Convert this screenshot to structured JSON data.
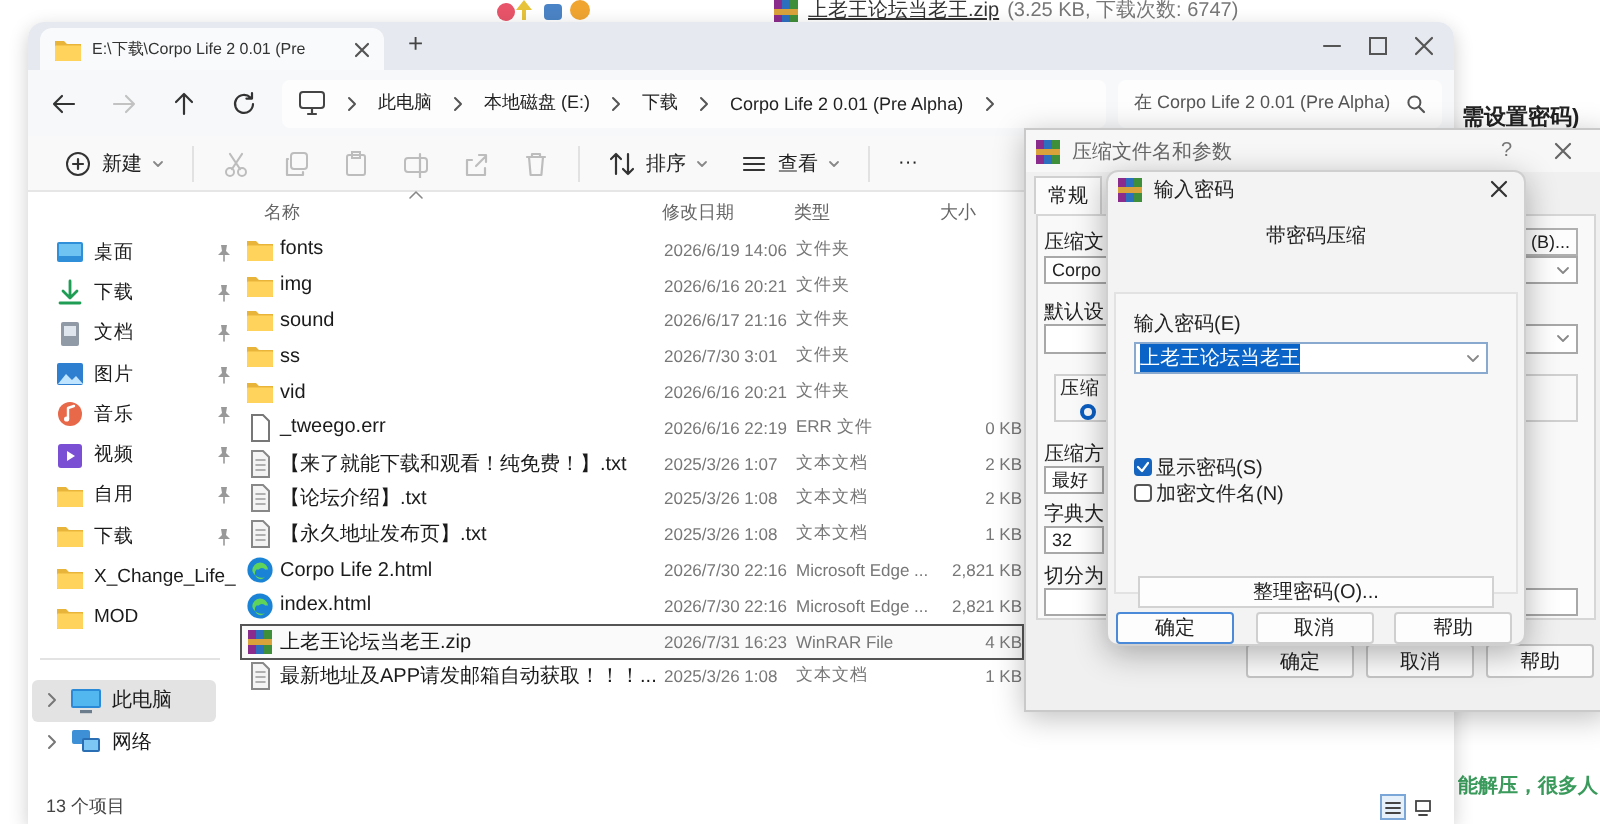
{
  "background_page": {
    "download_link": "上老王论坛当老王.zip",
    "download_info": "(3.25 KB, 下载次数: 6747)",
    "heading_fragment": "需设置密码)",
    "text_fragment": "能解压，很多人"
  },
  "explorer": {
    "tabs": [
      {
        "title": "E:\\下载\\Corpo Life 2 0.01 (Pre",
        "selected": true
      }
    ],
    "new_tab": "+",
    "nav": [
      {
        "kind": "back",
        "disabled": false
      },
      {
        "kind": "forward",
        "disabled": true
      },
      {
        "kind": "up",
        "disabled": false
      },
      {
        "kind": "refresh",
        "disabled": false
      }
    ],
    "breadcrumb": [
      "此电脑",
      "本地磁盘 (E:)",
      "下载",
      "Corpo Life 2 0.01 (Pre Alpha)"
    ],
    "search": {
      "placeholder": "在 Corpo Life 2 0.01 (Pre Alpha)"
    },
    "toolbar": [
      {
        "kind": "new",
        "label": "新建",
        "disabled": false
      },
      {
        "kind": "cut",
        "disabled": true
      },
      {
        "kind": "copy",
        "disabled": true
      },
      {
        "kind": "paste",
        "disabled": true
      },
      {
        "kind": "rename",
        "disabled": true
      },
      {
        "kind": "share",
        "disabled": true
      },
      {
        "kind": "delete",
        "disabled": true
      },
      {
        "kind": "sort",
        "label": "排序",
        "disabled": false
      },
      {
        "kind": "view",
        "label": "查看",
        "disabled": false
      },
      {
        "kind": "more",
        "label": "···",
        "disabled": false
      }
    ],
    "quick_access": [
      {
        "label": "桌面",
        "kind": "desktop",
        "pinned": true
      },
      {
        "label": "下载",
        "kind": "download",
        "pinned": true
      },
      {
        "label": "文档",
        "kind": "document",
        "pinned": true
      },
      {
        "label": "图片",
        "kind": "picture",
        "pinned": true
      },
      {
        "label": "音乐",
        "kind": "music",
        "pinned": true
      },
      {
        "label": "视频",
        "kind": "video",
        "pinned": true
      },
      {
        "label": "自用",
        "kind": "folder",
        "pinned": true
      },
      {
        "label": "下载",
        "kind": "folder",
        "pinned": true
      },
      {
        "label": "X_Change_Life_",
        "kind": "folder",
        "pinned": false
      },
      {
        "label": "MOD",
        "kind": "folder",
        "pinned": false
      }
    ],
    "tree": [
      {
        "label": "此电脑",
        "kind": "pc",
        "selected": true,
        "expanded": false
      },
      {
        "label": "网络",
        "kind": "network",
        "selected": false,
        "expanded": false
      }
    ],
    "columns": [
      "名称",
      "修改日期",
      "类型",
      "大小"
    ],
    "files": [
      {
        "name": "fonts",
        "date": "2026/6/19 14:06",
        "type": "文件夹",
        "kind": "folder",
        "selected": false
      },
      {
        "name": "img",
        "date": "2026/6/16 20:21",
        "type": "文件夹",
        "kind": "folder",
        "selected": false
      },
      {
        "name": "sound",
        "date": "2026/6/17 21:16",
        "type": "文件夹",
        "kind": "folder",
        "selected": false
      },
      {
        "name": "ss",
        "date": "2026/7/30 3:01",
        "type": "文件夹",
        "kind": "folder",
        "selected": false
      },
      {
        "name": "vid",
        "date": "2026/6/16 20:21",
        "type": "文件夹",
        "kind": "folder",
        "selected": false
      },
      {
        "name": "_tweego.err",
        "date": "2026/6/16 22:19",
        "type": "ERR 文件",
        "size": "0 KB",
        "kind": "file",
        "selected": false
      },
      {
        "name": "【来了就能下载和观看！纯免费！】.txt",
        "date": "2025/3/26 1:07",
        "type": "文本文档",
        "size": "2 KB",
        "kind": "text",
        "selected": false
      },
      {
        "name": "【论坛介绍】.txt",
        "date": "2025/3/26 1:08",
        "type": "文本文档",
        "size": "2 KB",
        "kind": "text",
        "selected": false
      },
      {
        "name": "【永久地址发布页】.txt",
        "date": "2025/3/26 1:08",
        "type": "文本文档",
        "size": "1 KB",
        "kind": "text",
        "selected": false
      },
      {
        "name": "Corpo Life 2.html",
        "date": "2026/7/30 22:16",
        "type": "Microsoft Edge ...",
        "size": "2,821 KB",
        "kind": "edge",
        "selected": false
      },
      {
        "name": "index.html",
        "date": "2026/7/30 22:16",
        "type": "Microsoft Edge ...",
        "size": "2,821 KB",
        "kind": "edge",
        "selected": false
      },
      {
        "name": "上老王论坛当老王.zip",
        "date": "2026/7/31 16:23",
        "type": "WinRAR File",
        "size": "4 KB",
        "kind": "zip",
        "selected": true
      },
      {
        "name": "最新地址及APP请发邮箱自动获取！！！...",
        "date": "2025/3/26 1:08",
        "type": "文本文档",
        "size": "1 KB",
        "kind": "text",
        "selected": false
      }
    ],
    "status": "13 个项目",
    "views": [
      {
        "kind": "details",
        "selected": true
      },
      {
        "kind": "tiles",
        "selected": false
      }
    ]
  },
  "archive_dialog": {
    "title": "压缩文件名和参数",
    "help": "?",
    "tabs": [
      {
        "label": "常规",
        "selected": true
      }
    ],
    "archive_label": "压缩文",
    "archive_name": "Corpo",
    "browse_button": "(B)...",
    "profile_label": "默认设",
    "group_label": "压缩",
    "format_radio": {
      "selected": true
    },
    "method_label": "压缩方",
    "method_value": "最好",
    "dictionary_label": "字典大",
    "dictionary_value": "32",
    "split_label": "切分为",
    "buttons": [
      "确定",
      "取消",
      "帮助"
    ]
  },
  "password_dialog": {
    "title": "输入密码",
    "heading": "带密码压缩",
    "password_label": "输入密码(E)",
    "password_value": "上老王论坛当老王",
    "options": [
      {
        "label": "显示密码(S)",
        "checked": true
      },
      {
        "label": "加密文件名(N)",
        "checked": false
      }
    ],
    "organize_button": "整理密码(O)...",
    "buttons": [
      {
        "label": "确定",
        "default": true
      },
      {
        "label": "取消",
        "default": false
      },
      {
        "label": "帮助",
        "default": false
      }
    ]
  }
}
